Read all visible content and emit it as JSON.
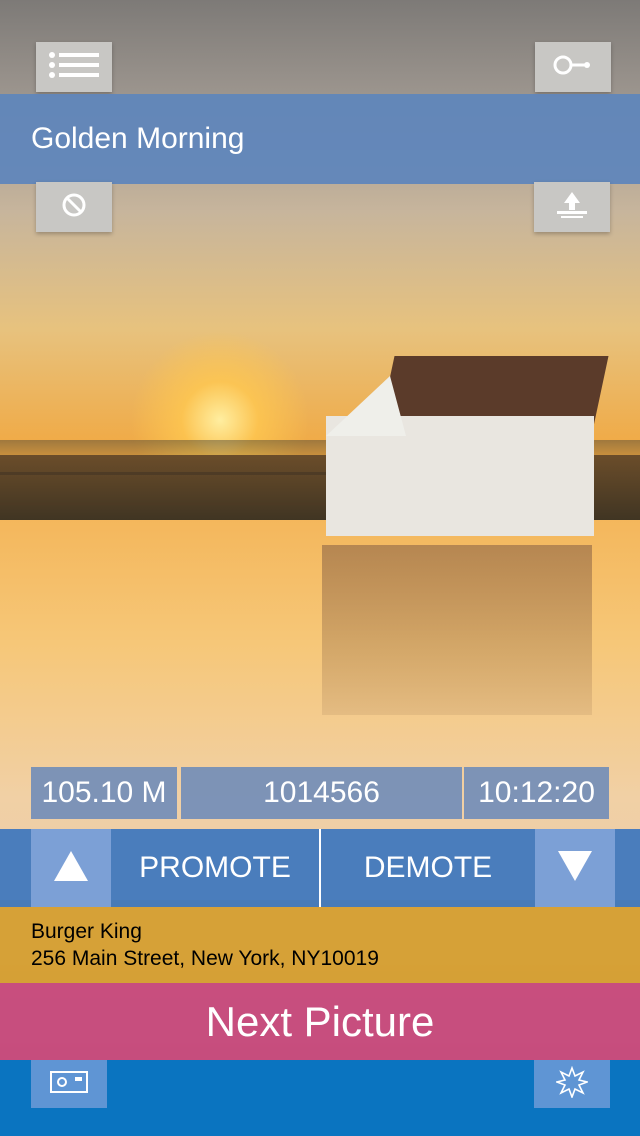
{
  "header": {
    "title": "Golden Morning"
  },
  "toolbar": {
    "menu_icon": "list-icon",
    "key_icon": "key-icon",
    "block_icon": "block-icon",
    "upload_icon": "upload-icon"
  },
  "stats": {
    "distance": "105.10 M",
    "id": "1014566",
    "time": "10:12:20"
  },
  "vote": {
    "promote_label": "PROMOTE",
    "demote_label": "DEMOTE",
    "up_icon": "triangle-up-icon",
    "down_icon": "triangle-down-icon"
  },
  "location": {
    "name": "Burger King",
    "address": "256 Main Street, New York,  NY10019"
  },
  "actions": {
    "next_label": "Next Picture"
  },
  "bottom": {
    "left_icon": "camera-icon",
    "right_icon": "starburst-icon"
  },
  "colors": {
    "title_bar": "#6086bb",
    "vote_bar": "#3c76be",
    "location_bar": "#d7a034",
    "next_button": "#c94880",
    "bottom_bar": "#0a74c0"
  }
}
